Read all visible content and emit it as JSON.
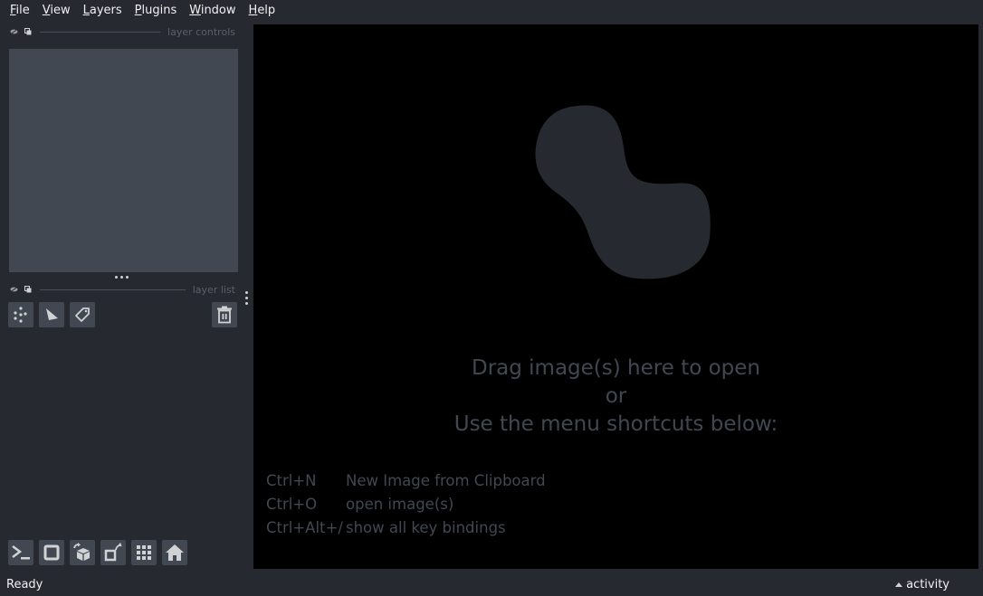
{
  "menubar": {
    "items": [
      {
        "label": "File",
        "mnemonic": "F",
        "rest": "ile"
      },
      {
        "label": "View",
        "mnemonic": "V",
        "rest": "iew"
      },
      {
        "label": "Layers",
        "mnemonic": "L",
        "rest": "ayers"
      },
      {
        "label": "Plugins",
        "mnemonic": "P",
        "rest": "lugins"
      },
      {
        "label": "Window",
        "mnemonic": "W",
        "rest": "indow"
      },
      {
        "label": "Help",
        "mnemonic": "H",
        "rest": "elp"
      }
    ]
  },
  "layer_controls": {
    "title": "layer controls"
  },
  "layer_list": {
    "title": "layer list",
    "buttons": [
      {
        "name": "new-points-layer",
        "icon": "points-icon"
      },
      {
        "name": "new-shapes-layer",
        "icon": "shapes-icon"
      },
      {
        "name": "new-labels-layer",
        "icon": "labels-icon"
      },
      {
        "name": "delete-layer",
        "icon": "trash-icon"
      }
    ]
  },
  "viewer_buttons": [
    {
      "name": "console",
      "icon": "console-icon"
    },
    {
      "name": "ndisplay",
      "icon": "square-icon"
    },
    {
      "name": "roll",
      "icon": "cube-rotate-icon"
    },
    {
      "name": "transpose",
      "icon": "transpose-icon"
    },
    {
      "name": "grid",
      "icon": "grid-icon"
    },
    {
      "name": "home",
      "icon": "home-icon"
    }
  ],
  "canvas": {
    "welcome_line1": "Drag image(s) here to open",
    "welcome_line2": "or",
    "welcome_line3": "Use the menu shortcuts below:",
    "shortcuts": [
      {
        "key": "Ctrl+N",
        "action": "New Image from Clipboard"
      },
      {
        "key": "Ctrl+O",
        "action": "open image(s)"
      },
      {
        "key": "Ctrl+Alt+/",
        "action": "show all key bindings"
      }
    ]
  },
  "statusbar": {
    "status": "Ready",
    "activity_label": "activity"
  },
  "colors": {
    "background": "#262930",
    "panel": "#414851",
    "canvas": "#000000",
    "text": "#f0f1f2",
    "muted": "#414851"
  }
}
